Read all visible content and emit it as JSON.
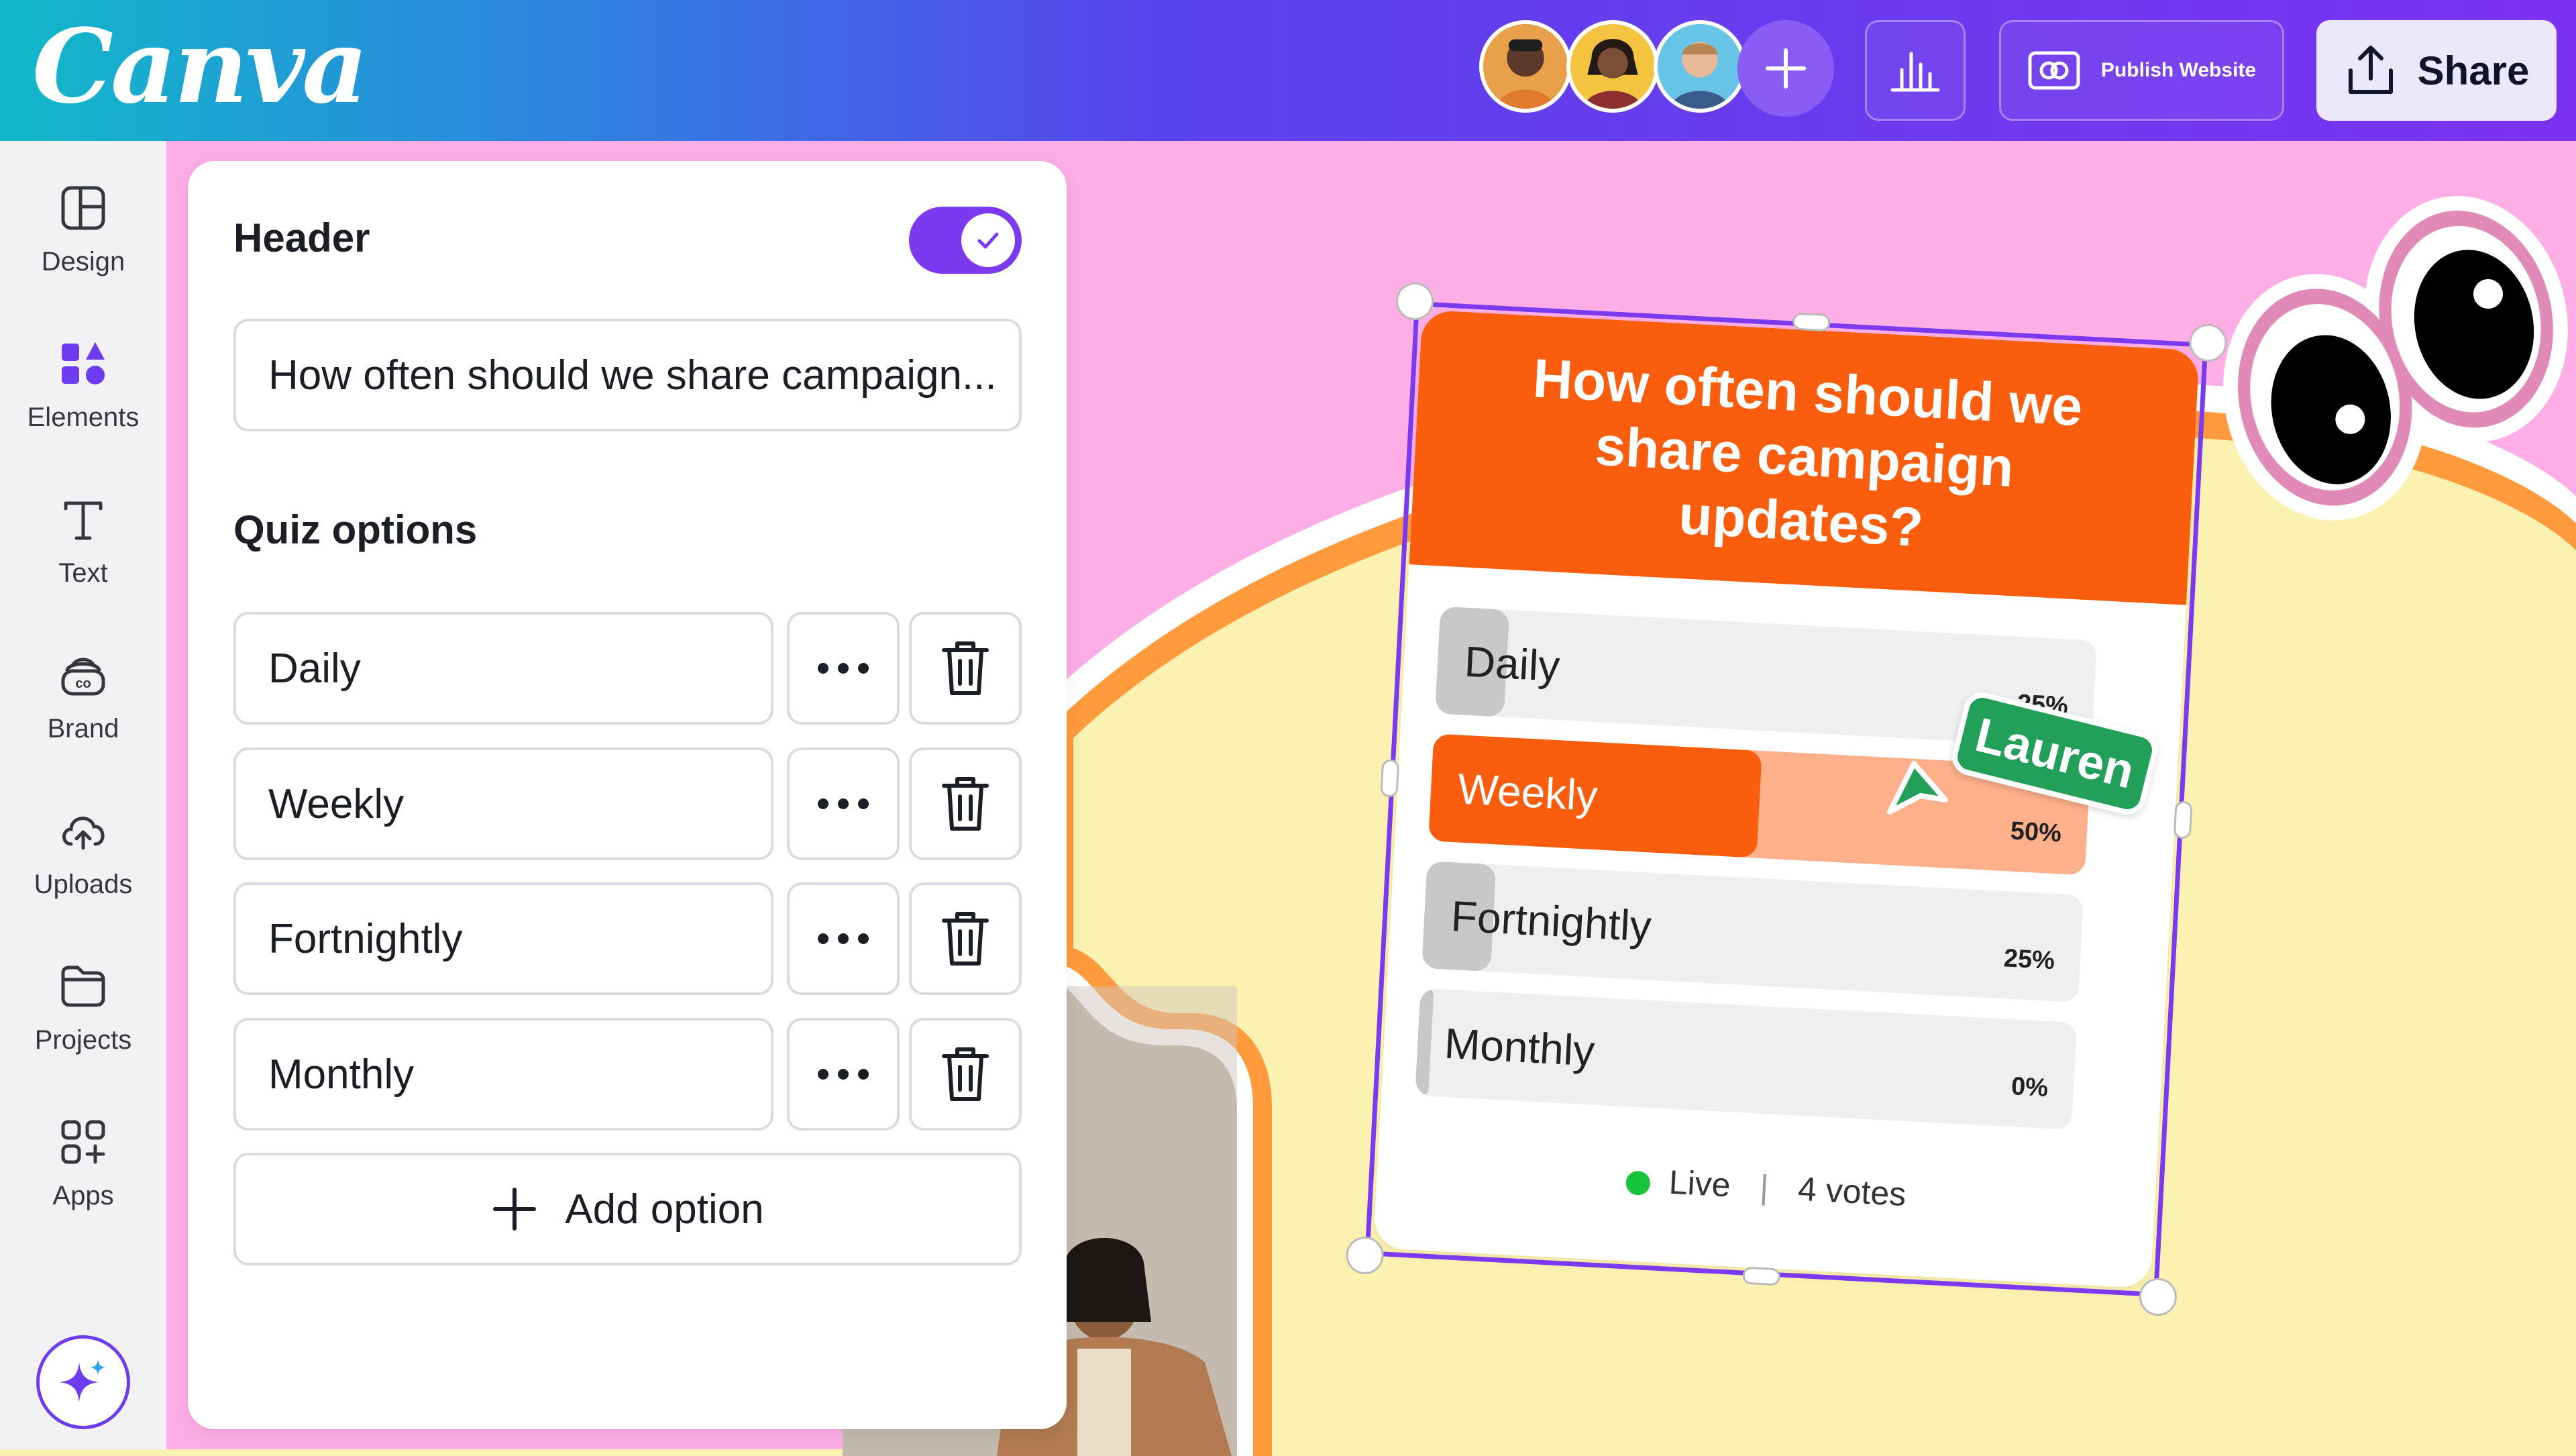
{
  "app": {
    "logo": "Canva"
  },
  "topbar": {
    "avatars": [
      "collaborator-1",
      "collaborator-2",
      "collaborator-3"
    ],
    "publish_label": "Publish Website",
    "share_label": "Share"
  },
  "sidebar": {
    "items": [
      {
        "label": "Design",
        "icon": "layout-icon"
      },
      {
        "label": "Elements",
        "icon": "shapes-icon"
      },
      {
        "label": "Text",
        "icon": "text-icon"
      },
      {
        "label": "Brand",
        "icon": "brand-icon"
      },
      {
        "label": "Uploads",
        "icon": "cloud-upload-icon"
      },
      {
        "label": "Projects",
        "icon": "folder-icon"
      },
      {
        "label": "Apps",
        "icon": "apps-icon"
      }
    ]
  },
  "panel": {
    "header_title": "Header",
    "header_enabled": true,
    "header_value": "How often should we share campaign...",
    "quiz_title": "Quiz options",
    "options": [
      "Daily",
      "Weekly",
      "Fortnightly",
      "Monthly"
    ],
    "add_option_label": "Add option"
  },
  "poll": {
    "question": "How often should we share campaign updates?",
    "results": [
      {
        "label": "Daily",
        "percent": "25%",
        "value": 25,
        "selected": false
      },
      {
        "label": "Weekly",
        "percent": "50%",
        "value": 50,
        "selected": true
      },
      {
        "label": "Fortnightly",
        "percent": "25%",
        "value": 25,
        "selected": false
      },
      {
        "label": "Monthly",
        "percent": "0%",
        "value": 0,
        "selected": false
      }
    ],
    "status": "Live",
    "votes": "4 votes"
  },
  "cursor": {
    "name": "Lauren"
  },
  "colors": {
    "accent": "#7c3af0",
    "poll_orange": "#fa5d0d",
    "poll_orange_light": "#fdb08a",
    "bar_grey": "#c8c8c8",
    "live_green": "#17c53a",
    "cursor_green": "#22a05a"
  }
}
